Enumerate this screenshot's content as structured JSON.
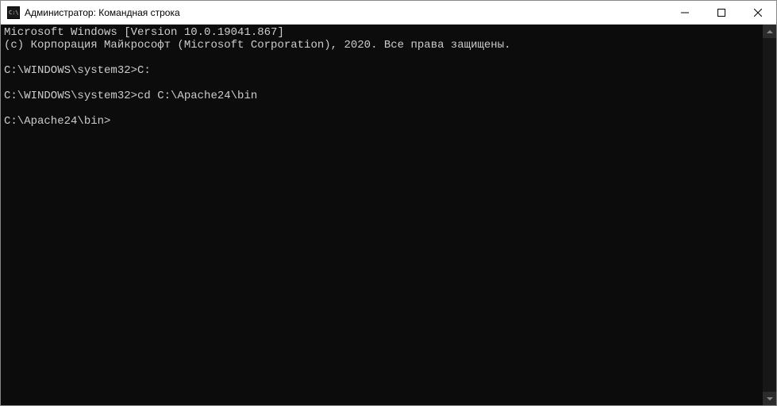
{
  "window": {
    "title": "Администратор: Командная строка"
  },
  "terminal": {
    "lines": [
      "Microsoft Windows [Version 10.0.19041.867]",
      "(c) Корпорация Майкрософт (Microsoft Corporation), 2020. Все права защищены.",
      "",
      "C:\\WINDOWS\\system32>C:",
      "",
      "C:\\WINDOWS\\system32>cd C:\\Apache24\\bin",
      "",
      "C:\\Apache24\\bin>"
    ]
  }
}
